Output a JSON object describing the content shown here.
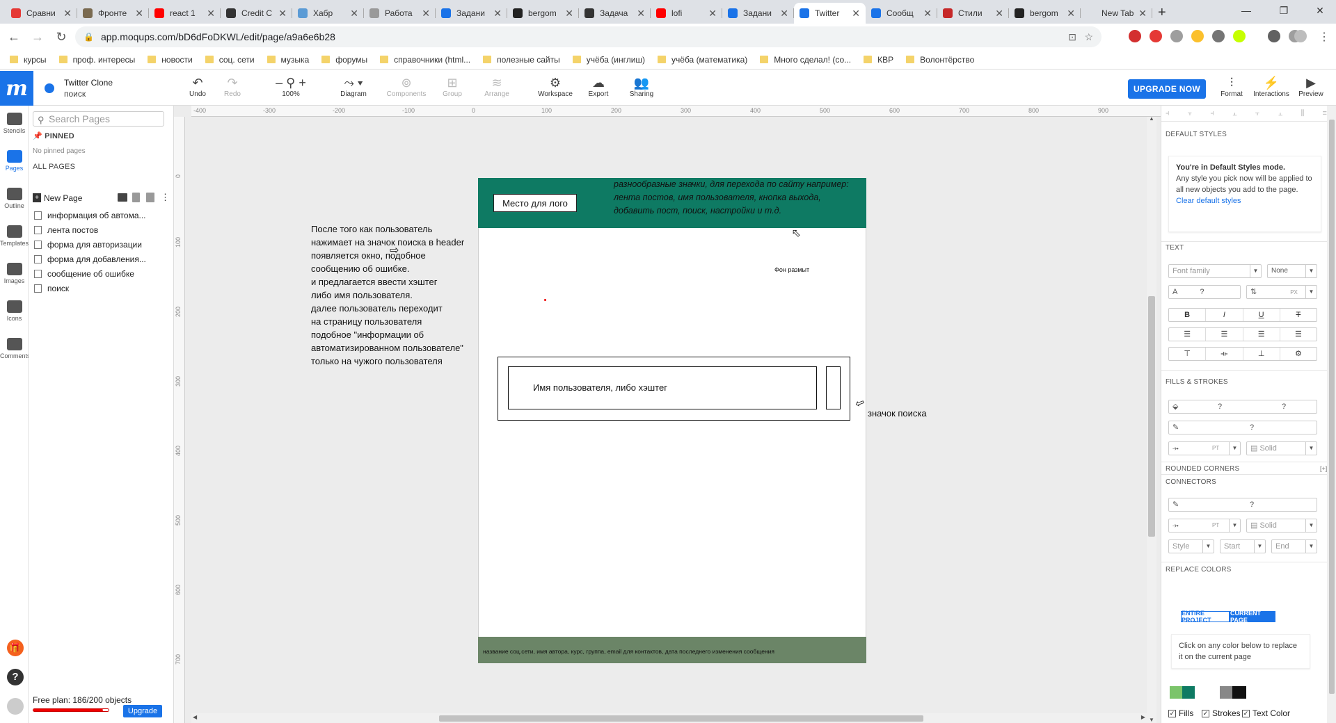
{
  "browser": {
    "tabs": [
      {
        "label": "Сравни",
        "color": "#e53935"
      },
      {
        "label": "Фронте",
        "color": "#7a6a50"
      },
      {
        "label": "react 1",
        "color": "#ff0000"
      },
      {
        "label": "Credit C",
        "color": "#333333"
      },
      {
        "label": "Хабр",
        "color": "#5b9bd5"
      },
      {
        "label": "Работа",
        "color": "#999999"
      },
      {
        "label": "Задани",
        "color": "#1a73e8"
      },
      {
        "label": "bergom",
        "color": "#222222"
      },
      {
        "label": "Задача",
        "color": "#333333"
      },
      {
        "label": "lofi",
        "color": "#ff0000"
      },
      {
        "label": "Задани",
        "color": "#1a73e8"
      },
      {
        "label": "Twitter",
        "color": "#1a73e8"
      },
      {
        "label": "Сообщ",
        "color": "#1a73e8"
      },
      {
        "label": "Стили",
        "color": "#c62828"
      },
      {
        "label": "bergom",
        "color": "#222222"
      },
      {
        "label": "New Tab",
        "color": "#dee1e6"
      }
    ],
    "active_tab_index": 11,
    "url": "app.moqups.com/bD6dFoDKWL/edit/page/a9a6e6b28",
    "bookmarks": [
      "курсы",
      "проф. интересы",
      "новости",
      "соц. сети",
      "музыка",
      "форумы",
      "справочники (html...",
      "полезные сайты",
      "учёба (инглиш)",
      "учёба (математика)",
      "Много сделал! (со...",
      "КВР",
      "Волонтёрство"
    ]
  },
  "app": {
    "logo": "m",
    "project_name": "Twitter Clone",
    "page_name": "поиск",
    "toolbar": [
      {
        "label": "Undo",
        "icon": "undo-icon",
        "glyph": "↶",
        "enabled": true
      },
      {
        "label": "Redo",
        "icon": "redo-icon",
        "glyph": "↷",
        "enabled": false
      },
      {
        "label": "100%",
        "icon": "zoom-icon",
        "glyph": "– ⚲ +",
        "enabled": true
      },
      {
        "label": "Diagram",
        "icon": "diagram-icon",
        "glyph": "⤳ ▾",
        "enabled": true
      },
      {
        "label": "Components",
        "icon": "components-icon",
        "glyph": "⊚",
        "enabled": false
      },
      {
        "label": "Group",
        "icon": "group-icon",
        "glyph": "⊞",
        "enabled": false
      },
      {
        "label": "Arrange",
        "icon": "arrange-icon",
        "glyph": "≋",
        "enabled": false
      },
      {
        "label": "Workspace",
        "icon": "workspace-icon",
        "glyph": "⚙",
        "enabled": true
      },
      {
        "label": "Export",
        "icon": "export-icon",
        "glyph": "☁",
        "enabled": true
      },
      {
        "label": "Sharing",
        "icon": "sharing-icon",
        "glyph": "👥",
        "enabled": true
      }
    ],
    "upgrade_label": "UPGRADE NOW",
    "right_tools": [
      {
        "label": "Format",
        "icon": "format-icon",
        "glyph": "⫶"
      },
      {
        "label": "Interactions",
        "icon": "interactions-icon",
        "glyph": "⚡"
      },
      {
        "label": "Preview",
        "icon": "preview-icon",
        "glyph": "▶"
      }
    ]
  },
  "rail": [
    {
      "label": "Stencils",
      "icon": "stencils-icon"
    },
    {
      "label": "Pages",
      "icon": "pages-icon",
      "active": true
    },
    {
      "label": "Outline",
      "icon": "outline-icon"
    },
    {
      "label": "Templates",
      "icon": "templates-icon"
    },
    {
      "label": "Images",
      "icon": "images-icon"
    },
    {
      "label": "Icons",
      "icon": "icons-icon"
    },
    {
      "label": "Comments",
      "icon": "comments-icon"
    }
  ],
  "pages_panel": {
    "search_placeholder": "Search Pages",
    "pinned_label": "PINNED",
    "no_pinned": "No pinned pages",
    "all_pages_label": "ALL PAGES",
    "new_page_label": "New Page",
    "pages": [
      "информация об автома...",
      "лента постов",
      "форма для авторизации",
      "форма для добавления...",
      "сообщение об ошибке",
      "поиск"
    ],
    "plan_text": "Free plan: 186/200 objects",
    "plan_used_fraction": 0.93,
    "upgrade_small": "Upgrade"
  },
  "ruler": {
    "h_ticks": [
      "-400",
      "-300",
      "-200",
      "-100",
      "0",
      "100",
      "200",
      "300",
      "400",
      "500",
      "600",
      "700",
      "800",
      "900"
    ],
    "v_ticks": [
      "0",
      "100",
      "200",
      "300",
      "400",
      "500",
      "600",
      "700"
    ]
  },
  "canvas": {
    "logo_placeholder": "Место для лого",
    "header_note": "разнообразные значки, для перехода по сайту например: лента постов, имя пользователя, кнопка выхода, добавить пост, поиск, настройки и т.д.",
    "left_note_lines": [
      "После того как пользователь",
      "нажимает на значок поиска в header",
      "появляется окно, подобное",
      "сообщению об ошибке.",
      "и предлагается ввести хэштег",
      "либо имя пользователя.",
      "далее пользователь переходит",
      "на страницу пользователя",
      "подобное \"информации об",
      "автоматизированном пользователе\"",
      "только на чужого пользователя"
    ],
    "bg_blur_label": "Фон размыт",
    "search_placeholder": "Имя пользователя, либо хэштег",
    "search_icon_label": "значок поиска",
    "footer_text": "название соц.сети, имя автора, курс, группа, email для контактов, дата последнего изменения сообщения",
    "colors": {
      "header": "#0e7a63",
      "footer": "#6b8567"
    }
  },
  "right_panel": {
    "default_styles": "DEFAULT STYLES",
    "mode_title": "You're in Default Styles mode.",
    "mode_text": "Any style you pick now will be applied to all new objects you add to the page.",
    "clear_link": "Clear default styles",
    "text_section": "TEXT",
    "font_family": "Font family",
    "font_none": "None",
    "size_placeholder": "?",
    "line_unit": "PX",
    "fills_section": "FILLS & STROKES",
    "stroke_unit": "PT",
    "solid": "Solid",
    "rounded_corners": "ROUNDED CORNERS",
    "rounded_add": "[+]",
    "connectors": "CONNECTORS",
    "style_label": "Style",
    "start_label": "Start",
    "end_label": "End",
    "replace_colors": "REPLACE COLORS",
    "entire_project": "ENTIRE PROJECT",
    "current_page": "CURRENT PAGE",
    "replace_hint": "Click on any color below to replace it on the current page",
    "swatches": [
      "#7bc46a",
      "#0e7a63",
      "#ffffff",
      "#ffffff",
      "#888888",
      "#111111"
    ],
    "checks": [
      "Fills",
      "Strokes",
      "Text Color"
    ]
  }
}
